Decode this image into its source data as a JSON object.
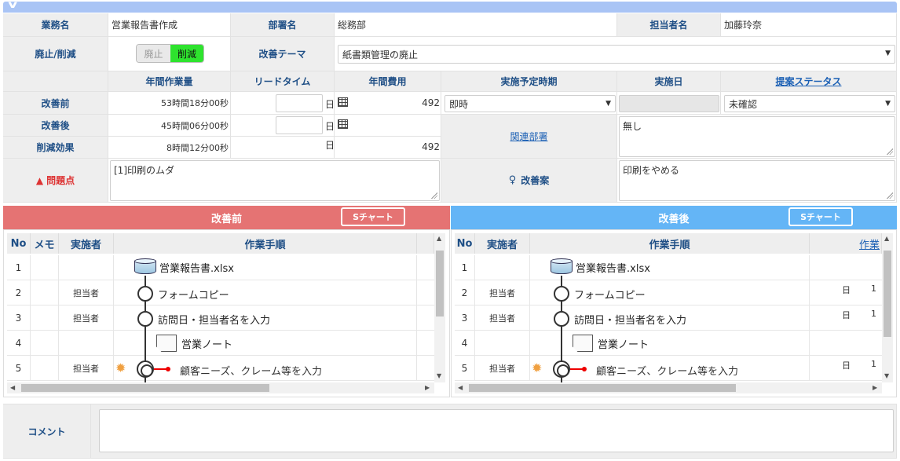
{
  "form": {
    "business_name_label": "業務名",
    "business_name_value": "営業報告書作成",
    "department_label": "部署名",
    "department_value": "総務部",
    "assignee_label": "担当者名",
    "assignee_value": "加藤玲奈",
    "abolish_reduce_label": "廃止/削減",
    "toggle_off_label": "廃止",
    "toggle_on_label": "削減",
    "theme_label": "改善テーマ",
    "theme_value": "紙書類管理の廃止",
    "col_annual_hours": "年間作業量",
    "col_lead_time": "リードタイム",
    "col_annual_cost": "年間費用",
    "col_planned_date": "実施予定時期",
    "col_exec_date": "実施日",
    "col_proposal_status": "提案ステータス",
    "before_label": "改善前",
    "after_label": "改善後",
    "effect_label": "削減効果",
    "before_hours": "53時間18分00秒",
    "after_hours": "45時間06分00秒",
    "effect_hours": "8時間12分00秒",
    "day_unit": "日",
    "before_cost": "492",
    "effect_cost": "492",
    "planned_value": "即時",
    "status_value": "未確認",
    "related_dept_label": "関連部署",
    "related_dept_value": "無し",
    "problem_label": "問題点",
    "problem_value": "[1]印刷のムダ",
    "proposal_label": "改善案",
    "proposal_value": "印刷をやめる"
  },
  "left_panel": {
    "title": "改善前",
    "schart_label": "Sチャート",
    "headers": {
      "no": "No",
      "memo": "メモ",
      "actor": "実施者",
      "steps": "作業手順"
    },
    "rows": [
      {
        "no": "1",
        "actor": "",
        "step": "営業報告書.xlsx"
      },
      {
        "no": "2",
        "actor": "担当者",
        "step": "フォームコピー"
      },
      {
        "no": "3",
        "actor": "担当者",
        "step": "訪問日・担当者名を入力"
      },
      {
        "no": "4",
        "actor": "",
        "step": "営業ノート"
      },
      {
        "no": "5",
        "actor": "担当者",
        "step": "顧客ニーズ、クレーム等を入力"
      }
    ]
  },
  "right_panel": {
    "title": "改善後",
    "schart_label": "Sチャート",
    "headers": {
      "no": "No",
      "actor": "実施者",
      "steps": "作業手順",
      "extra": "作業"
    },
    "rows": [
      {
        "no": "1",
        "actor": "",
        "step": "営業報告書.xlsx",
        "day": "",
        "extra": ""
      },
      {
        "no": "2",
        "actor": "担当者",
        "step": "フォームコピー",
        "day": "日",
        "extra": "1"
      },
      {
        "no": "3",
        "actor": "担当者",
        "step": "訪問日・担当者名を入力",
        "day": "日",
        "extra": "1"
      },
      {
        "no": "4",
        "actor": "",
        "step": "営業ノート",
        "day": "",
        "extra": ""
      },
      {
        "no": "5",
        "actor": "担当者",
        "step": "顧客ニーズ、クレーム等を入力",
        "day": "日",
        "extra": "1"
      }
    ]
  },
  "comment": {
    "label": "コメント",
    "value": ""
  },
  "colors": {
    "before_header": "#e57373",
    "after_header": "#64b5f6",
    "top_bar": "#a9c4f5",
    "toggle_on": "#2ee32e"
  }
}
